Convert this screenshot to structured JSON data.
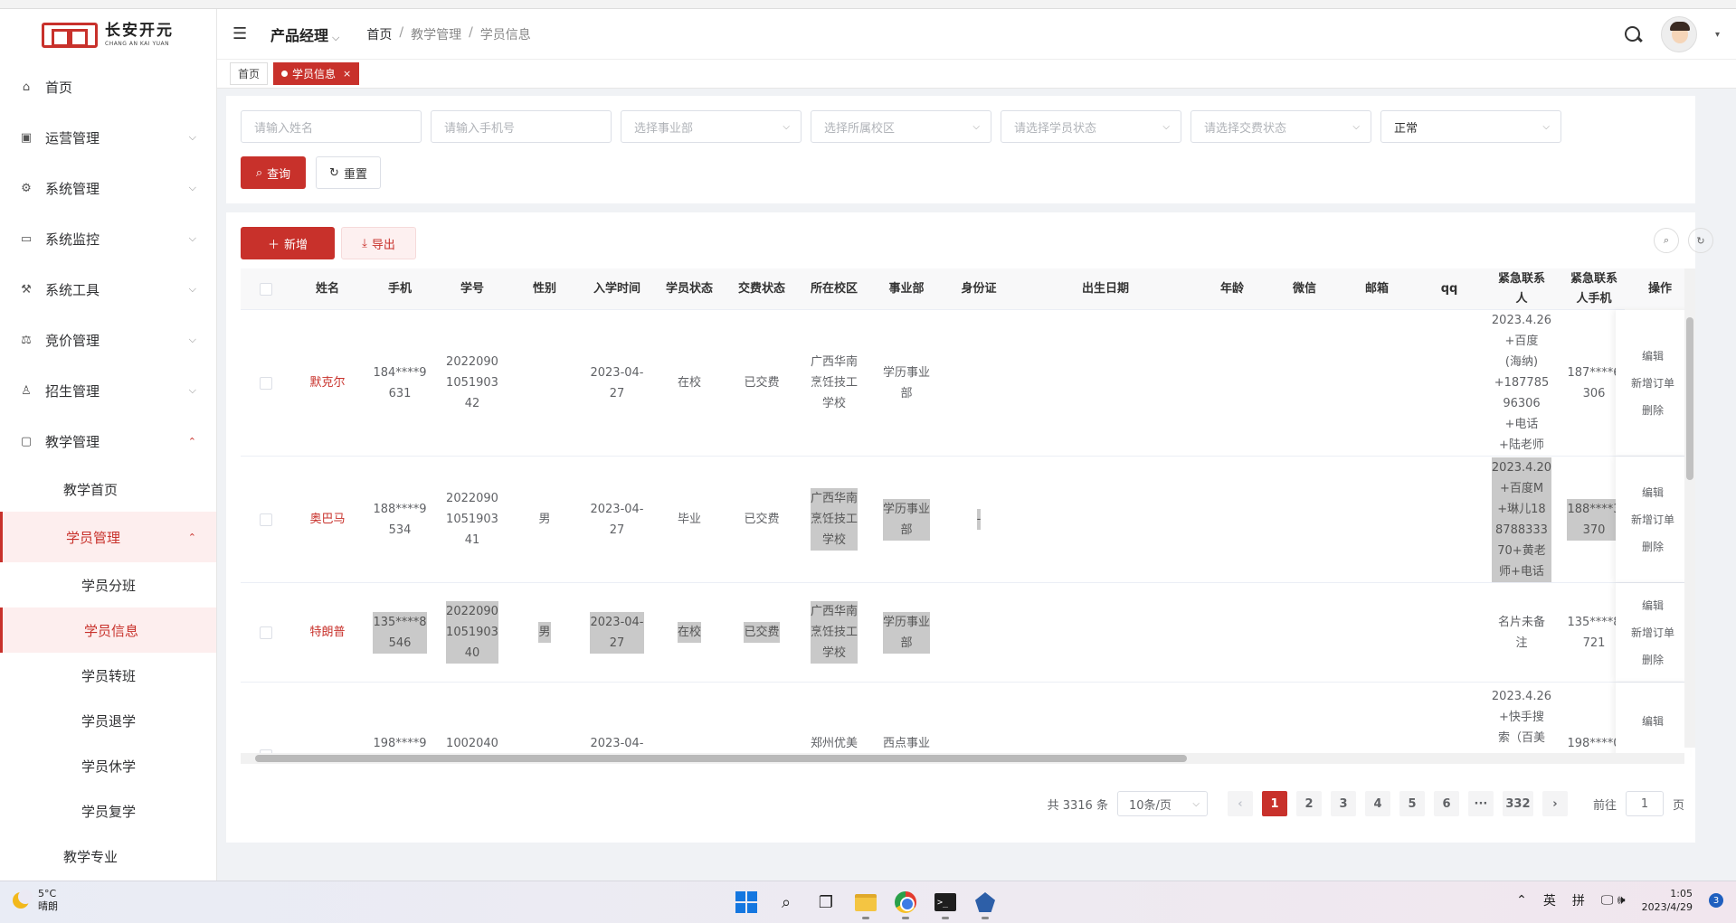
{
  "brand": {
    "name_cn": "长安开元",
    "name_en": "CHANG AN KAI YUAN"
  },
  "sidebar": {
    "items": [
      {
        "label": "首页",
        "icon": "bank-icon"
      },
      {
        "label": "运营管理",
        "icon": "monitor-icon"
      },
      {
        "label": "系统管理",
        "icon": "gear-icon"
      },
      {
        "label": "系统监控",
        "icon": "screen-icon"
      },
      {
        "label": "系统工具",
        "icon": "tools-icon"
      },
      {
        "label": "竞价管理",
        "icon": "hammer-icon"
      },
      {
        "label": "招生管理",
        "icon": "user-icon"
      },
      {
        "label": "教学管理",
        "icon": "desktop-icon"
      }
    ],
    "teaching_sub": {
      "home": "教学首页",
      "student_mgmt": "学员管理",
      "major": "教学专业"
    },
    "student_sub": [
      "学员分班",
      "学员信息",
      "学员转班",
      "学员退学",
      "学员休学",
      "学员复学"
    ]
  },
  "header": {
    "role": "产品经理",
    "breadcrumb": [
      "首页",
      "教学管理",
      "学员信息"
    ]
  },
  "tabs": [
    {
      "label": "首页"
    },
    {
      "label": "学员信息",
      "close": "×"
    }
  ],
  "filters": {
    "name_placeholder": "请输入姓名",
    "phone_placeholder": "请输入手机号",
    "dept_placeholder": "选择事业部",
    "campus_placeholder": "选择所属校区",
    "status_placeholder": "请选择学员状态",
    "pay_placeholder": "请选择交费状态",
    "state_value": "正常",
    "query_label": "查询",
    "reset_label": "重置"
  },
  "toolbar": {
    "add_label": "新增",
    "export_label": "导出"
  },
  "table": {
    "columns": [
      "姓名",
      "手机",
      "学号",
      "性别",
      "入学时间",
      "学员状态",
      "交费状态",
      "所在校区",
      "事业部",
      "身份证",
      "出生日期",
      "年龄",
      "微信",
      "邮箱",
      "qq",
      "紧急联系人",
      "紧急联系人手机",
      "操作"
    ],
    "ops": [
      "编辑",
      "新增订单",
      "删除"
    ],
    "rows": [
      {
        "name": "默克尔",
        "phone": [
          "184****9",
          "631"
        ],
        "sid": [
          "2022090",
          "1051903",
          "42"
        ],
        "gender": "",
        "date": [
          "2023-04-",
          "27"
        ],
        "status": "在校",
        "pay": "已交费",
        "campus": [
          "广西华南",
          "烹饪技工",
          "学校"
        ],
        "dept": [
          "学历事业",
          "部"
        ],
        "idcard": "",
        "contact": [
          "2023.4.26",
          "+百度",
          "(海纳)",
          "+187785",
          "96306",
          "+电话",
          "+陆老师"
        ],
        "cphone": [
          "187****6",
          "306"
        ]
      },
      {
        "name": "奥巴马",
        "phone": [
          "188****9",
          "534"
        ],
        "sid": [
          "2022090",
          "1051903",
          "41"
        ],
        "gender": "男",
        "date": [
          "2023-04-",
          "27"
        ],
        "status": "毕业",
        "pay": "已交费",
        "campus": [
          "广西华南",
          "烹饪技工",
          "学校"
        ],
        "dept": [
          "学历事业",
          "部"
        ],
        "idcard": "-",
        "contact": [
          "2023.4.20",
          "+百度M",
          "+琳儿18",
          "8788333",
          "70+黄老",
          "师+电话"
        ],
        "cphone": [
          "188****3",
          "370"
        ]
      },
      {
        "name": "特朗普",
        "phone": [
          "135****8",
          "546"
        ],
        "sid": [
          "2022090",
          "1051903",
          "40"
        ],
        "gender": "男",
        "date": [
          "2023-04-",
          "27"
        ],
        "status": "在校",
        "pay": "已交费",
        "campus": [
          "广西华南",
          "烹饪技工",
          "学校"
        ],
        "dept": [
          "学历事业",
          "部"
        ],
        "idcard": "",
        "contact": [
          "名片未备",
          "注"
        ],
        "cphone": [
          "135****8",
          "721"
        ]
      },
      {
        "name": "",
        "phone": [
          "198****9"
        ],
        "sid": [
          "1002040"
        ],
        "gender": "",
        "date": [
          "2023-04-"
        ],
        "status": "",
        "pay": "",
        "campus": [
          "郑州优美"
        ],
        "dept": [
          "西点事业"
        ],
        "idcard": "",
        "contact": [
          "2023.4.26",
          "+快手搜",
          "索（百美"
        ],
        "cphone": [
          "198****0"
        ]
      }
    ]
  },
  "pagination": {
    "total": "共 3316 条",
    "page_size": "10条/页",
    "pages": [
      "1",
      "2",
      "3",
      "4",
      "5",
      "6",
      "···",
      "332"
    ],
    "goto_label": "前往",
    "goto_value": "1",
    "page_suffix": "页"
  },
  "taskbar": {
    "temp": "5°C",
    "weather": "晴朗",
    "ime_lang": "英",
    "ime_mode": "拼",
    "time": "1:05",
    "date": "2023/4/29",
    "notify_count": "3"
  }
}
